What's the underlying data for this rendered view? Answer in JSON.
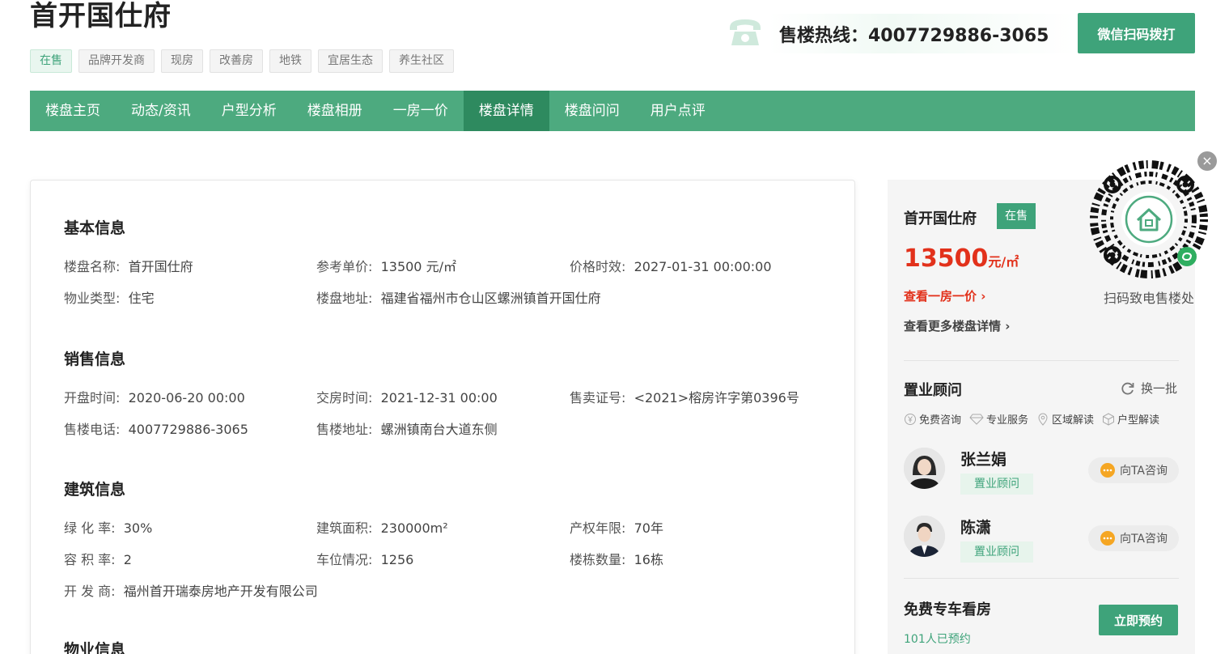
{
  "project": {
    "title": "首开国仕府",
    "tags": [
      "在售",
      "品牌开发商",
      "现房",
      "改善房",
      "地铁",
      "宜居生态",
      "养生社区"
    ]
  },
  "hotline": {
    "icon": "phone-icon",
    "text": "售楼热线：4007729886-3065",
    "wechat_button": "微信扫码拨打"
  },
  "nav": {
    "items": [
      "楼盘主页",
      "动态/资讯",
      "户型分析",
      "楼盘相册",
      "一房一价",
      "楼盘详情",
      "楼盘问问",
      "用户点评"
    ],
    "active": "楼盘详情"
  },
  "sections": {
    "basic": {
      "title": "基本信息",
      "rows": [
        [
          {
            "label": "楼盘名称:",
            "value": "首开国仕府"
          },
          {
            "label": "参考单价:",
            "value": "13500 元/㎡"
          },
          {
            "label": "价格时效:",
            "value": "2027-01-31 00:00:00"
          }
        ],
        [
          {
            "label": "物业类型:",
            "value": "住宅"
          },
          {
            "label": "楼盘地址:",
            "value": "福建省福州市仓山区螺洲镇首开国仕府"
          }
        ]
      ]
    },
    "sales": {
      "title": "销售信息",
      "rows": [
        [
          {
            "label": "开盘时间:",
            "value": "2020-06-20 00:00"
          },
          {
            "label": "交房时间:",
            "value": "2021-12-31 00:00"
          },
          {
            "label": "售卖证号:",
            "value": "<2021>榕房许字第0396号"
          }
        ],
        [
          {
            "label": "售楼电话:",
            "value": "4007729886-3065"
          },
          {
            "label": "售楼地址:",
            "value": "螺洲镇南台大道东侧"
          }
        ]
      ]
    },
    "building": {
      "title": "建筑信息",
      "rows": [
        [
          {
            "label": "绿 化 率:",
            "value": "30%"
          },
          {
            "label": "建筑面积:",
            "value": "230000m²"
          },
          {
            "label": "产权年限:",
            "value": "70年"
          }
        ],
        [
          {
            "label": "容 积 率:",
            "value": "2"
          },
          {
            "label": "车位情况:",
            "value": "1256"
          },
          {
            "label": "楼栋数量:",
            "value": "16栋"
          }
        ],
        [
          {
            "label": "开 发 商:",
            "value": "福州首开瑞泰房地产开发有限公司"
          }
        ]
      ]
    },
    "property": {
      "title": "物业信息"
    }
  },
  "sidebar": {
    "name": "首开国仕府",
    "badge": "在售",
    "price_value": "13500",
    "price_unit": "元/㎡",
    "link_price": "查看一房一价 ›",
    "link_detail": "查看更多楼盘详情 ›",
    "advisor_title": "置业顾问",
    "refresh": "换一批",
    "features": [
      "免费咨询",
      "专业服务",
      "区域解读",
      "户型解读"
    ],
    "advisors": [
      {
        "name": "张兰娟",
        "role": "置业顾问",
        "button": "向TA咨询"
      },
      {
        "name": "陈潇",
        "role": "置业顾问",
        "button": "向TA咨询"
      }
    ],
    "car_title": "免费专车看房",
    "car_count": "101人已预约",
    "book_button": "立即预约"
  },
  "qr": {
    "caption": "扫码致电售楼处",
    "close": "×"
  },
  "colors": {
    "brand_green": "#3ea37a",
    "nav_green": "#4daa7f",
    "nav_active": "#2e8a5f",
    "price_red": "#e2311b"
  }
}
